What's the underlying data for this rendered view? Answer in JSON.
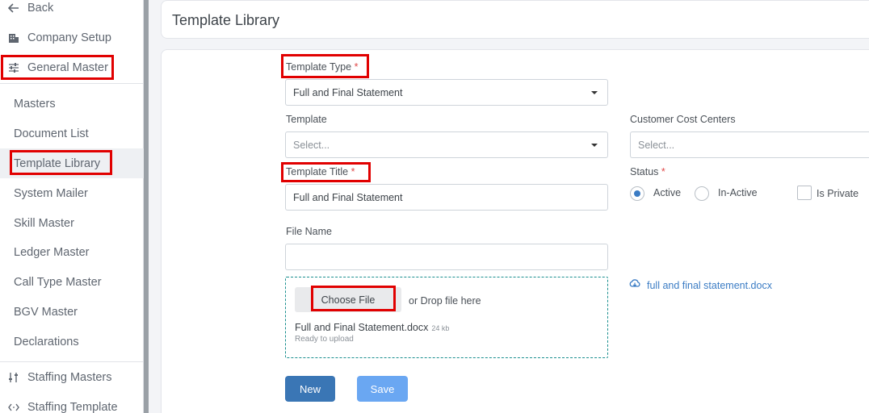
{
  "sidebar": {
    "back_label": "Back",
    "company_setup_label": "Company Setup",
    "general_master_label": "General Master",
    "sub_items": [
      {
        "label": "Masters"
      },
      {
        "label": "Document List"
      },
      {
        "label": "Template Library"
      },
      {
        "label": "System Mailer"
      },
      {
        "label": "Skill Master"
      },
      {
        "label": "Ledger Master"
      },
      {
        "label": "Call Type Master"
      },
      {
        "label": "BGV Master"
      },
      {
        "label": "Declarations"
      }
    ],
    "staffing_masters_label": "Staffing Masters",
    "staffing_template_label": "Staffing Template"
  },
  "header": {
    "title": "Template Library"
  },
  "form": {
    "template_type": {
      "label": "Template Type",
      "required": "*",
      "value": "Full and Final Statement"
    },
    "template": {
      "label": "Template",
      "placeholder": "Select..."
    },
    "customer_cost_centers": {
      "label": "Customer Cost Centers",
      "placeholder": "Select..."
    },
    "template_title": {
      "label": "Template Title",
      "required": "*",
      "value": "Full and Final Statement"
    },
    "status": {
      "label": "Status",
      "required": "*",
      "active_label": "Active",
      "inactive_label": "In-Active",
      "selected": "Active"
    },
    "is_private_label": "Is Private",
    "file_name": {
      "label": "File Name",
      "value": ""
    },
    "upload": {
      "choose_label": "Choose File",
      "drop_text": "or Drop file here",
      "file_name": "Full and Final Statement.docx",
      "file_size": "24 kb",
      "file_status": "Ready to upload"
    },
    "existing_file_link": "full and final statement.docx",
    "new_label": "New",
    "save_label": "Save"
  },
  "colors": {
    "highlight": "#e10000",
    "primary": "#3a76b5",
    "save": "#6aa7f2",
    "link": "#3b7cc4"
  }
}
